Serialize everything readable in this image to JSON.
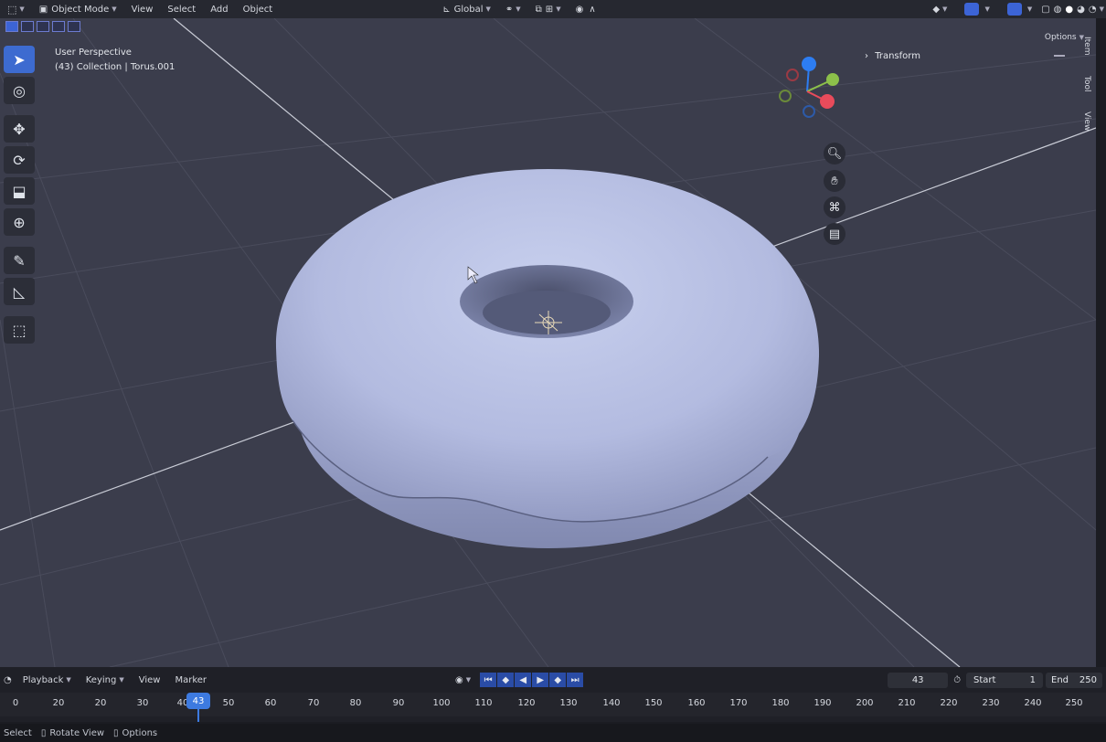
{
  "header": {
    "mode": "Object Mode",
    "menus": [
      "View",
      "Select",
      "Add",
      "Object"
    ],
    "transform_orientation": "Global",
    "icons": [
      "editor-type-icon",
      "mode-icon",
      "transform-orientation-icon",
      "pivot-icon",
      "snap-icon",
      "proportional-edit-icon",
      "visibility-icon",
      "gizmo-icon",
      "overlay-icon",
      "xray-icon",
      "shading-wireframe-icon",
      "shading-solid-icon",
      "shading-material-icon",
      "shading-rendered-icon"
    ]
  },
  "viewport": {
    "view_name": "User Perspective",
    "collection_info": "(43) Collection | Torus.001",
    "options_label": "Options",
    "background_color": "#3b3d4c",
    "object_color": "#b4bde0"
  },
  "toolbar": {
    "tools": [
      "select-box",
      "cursor",
      "move",
      "rotate",
      "scale",
      "transform",
      "annotate",
      "measure",
      "add-cube"
    ],
    "active": "select-box"
  },
  "gizmo": {
    "axis_colors": {
      "x": "#e84b5b",
      "y": "#8cc04a",
      "z": "#2d7df2"
    },
    "nav_buttons": [
      "zoom",
      "pan",
      "camera",
      "perspective"
    ]
  },
  "sidebar": {
    "panel": "Transform",
    "tabs": [
      "Item",
      "Tool",
      "View"
    ]
  },
  "timeline": {
    "menus": [
      "Playback",
      "Keying",
      "View",
      "Marker"
    ],
    "current_frame": "43",
    "start_label": "Start",
    "start_value": "1",
    "end_label": "End",
    "end_value": "250",
    "ruler_ticks": [
      "0",
      "20",
      "20",
      "30",
      "40",
      "50",
      "60",
      "70",
      "80",
      "90",
      "100",
      "110",
      "120",
      "130",
      "140",
      "150",
      "160",
      "170",
      "180",
      "190",
      "200",
      "210",
      "220",
      "230",
      "240",
      "250"
    ],
    "accent_color": "#3d7ae0"
  },
  "status": {
    "items": [
      "Select",
      "Rotate View",
      "Options"
    ]
  }
}
